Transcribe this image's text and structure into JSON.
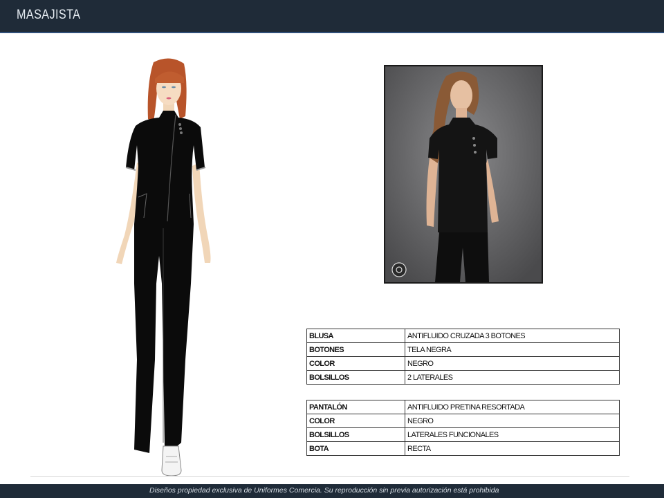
{
  "header": {
    "title": "MASAJISTA"
  },
  "footer": {
    "text": "Diseños propiedad exclusiva de Uniformes Comercia. Su reproducción sin previa autorización está prohibida"
  },
  "specs_blusa": [
    {
      "key": "BLUSA",
      "value": "ANTIFLUIDO CRUZADA 3 BOTONES"
    },
    {
      "key": "BOTONES",
      "value": "TELA NEGRA"
    },
    {
      "key": "COLOR",
      "value": "NEGRO"
    },
    {
      "key": "BOLSILLOS",
      "value": "2 LATERALES"
    }
  ],
  "specs_pantalon": [
    {
      "key": "PANTALÓN",
      "value": "ANTIFLUIDO PRETINA RESORTADA"
    },
    {
      "key": "COLOR",
      "value": "NEGRO"
    },
    {
      "key": "BOLSILLOS",
      "value": "LATERALES FUNCIONALES"
    },
    {
      "key": "BOTA",
      "value": "RECTA"
    }
  ],
  "colors": {
    "header_bg": "#1f2b38",
    "garment": "#0b0b0b",
    "hair": "#b8542a"
  },
  "icons": {
    "photo_overlay": "lens-icon"
  }
}
